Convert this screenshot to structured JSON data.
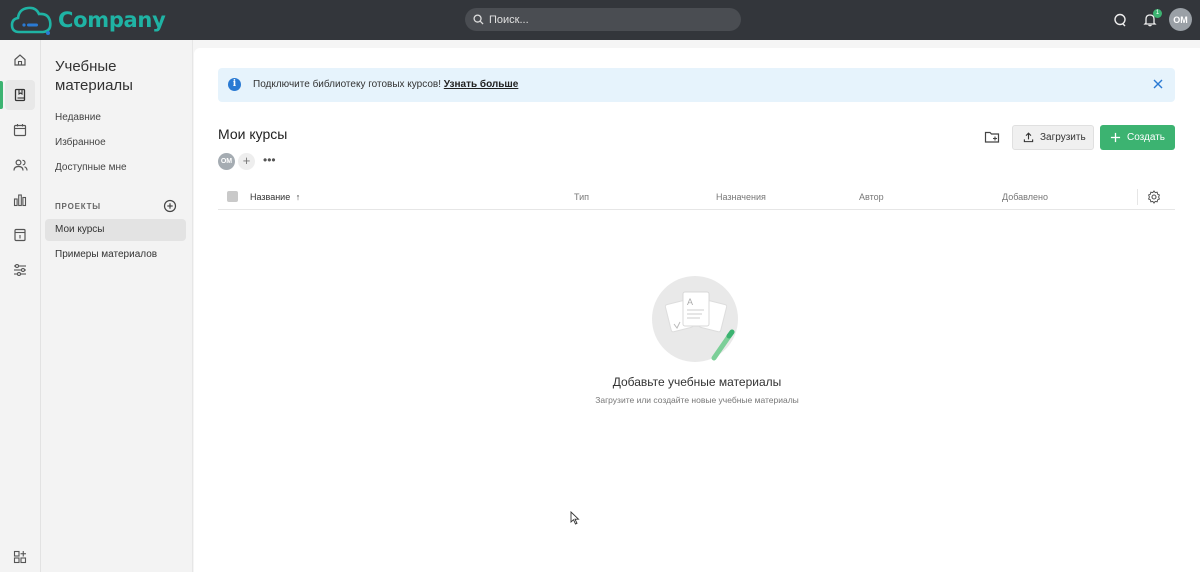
{
  "app": {
    "brand": "Company",
    "brand_color": "#1fb3a4",
    "accent": "#3cb371"
  },
  "topbar": {
    "search_placeholder": "Поиск...",
    "notifications_count": "1",
    "user_initials": "ОМ"
  },
  "rail": {
    "items": [
      "home-icon",
      "book-icon",
      "calendar-icon",
      "users-icon",
      "chart-icon",
      "page-icon",
      "sliders-icon",
      "apps-add-icon"
    ],
    "active": "book-icon"
  },
  "sidebar": {
    "title": "Учебные материалы",
    "links": [
      "Недавние",
      "Избранное",
      "Доступные мне"
    ],
    "section_label": "ПРОЕКТЫ",
    "projects": [
      {
        "label": "Мои курсы",
        "active": true
      },
      {
        "label": "Примеры материалов",
        "active": false
      }
    ]
  },
  "banner": {
    "text": "Подключите библиотеку готовых курсов!",
    "link": "Узнать больше"
  },
  "main": {
    "title": "Мои курсы",
    "upload_label": "Загрузить",
    "create_label": "Создать",
    "member_initials": "ОМ",
    "more": "•••"
  },
  "table": {
    "columns": [
      "Название",
      "Тип",
      "Назначения",
      "Автор",
      "Добавлено"
    ],
    "sorted_by": "Название"
  },
  "empty": {
    "title": "Добавьте учебные материалы",
    "subtitle": "Загрузите или создайте новые учебные материалы"
  }
}
